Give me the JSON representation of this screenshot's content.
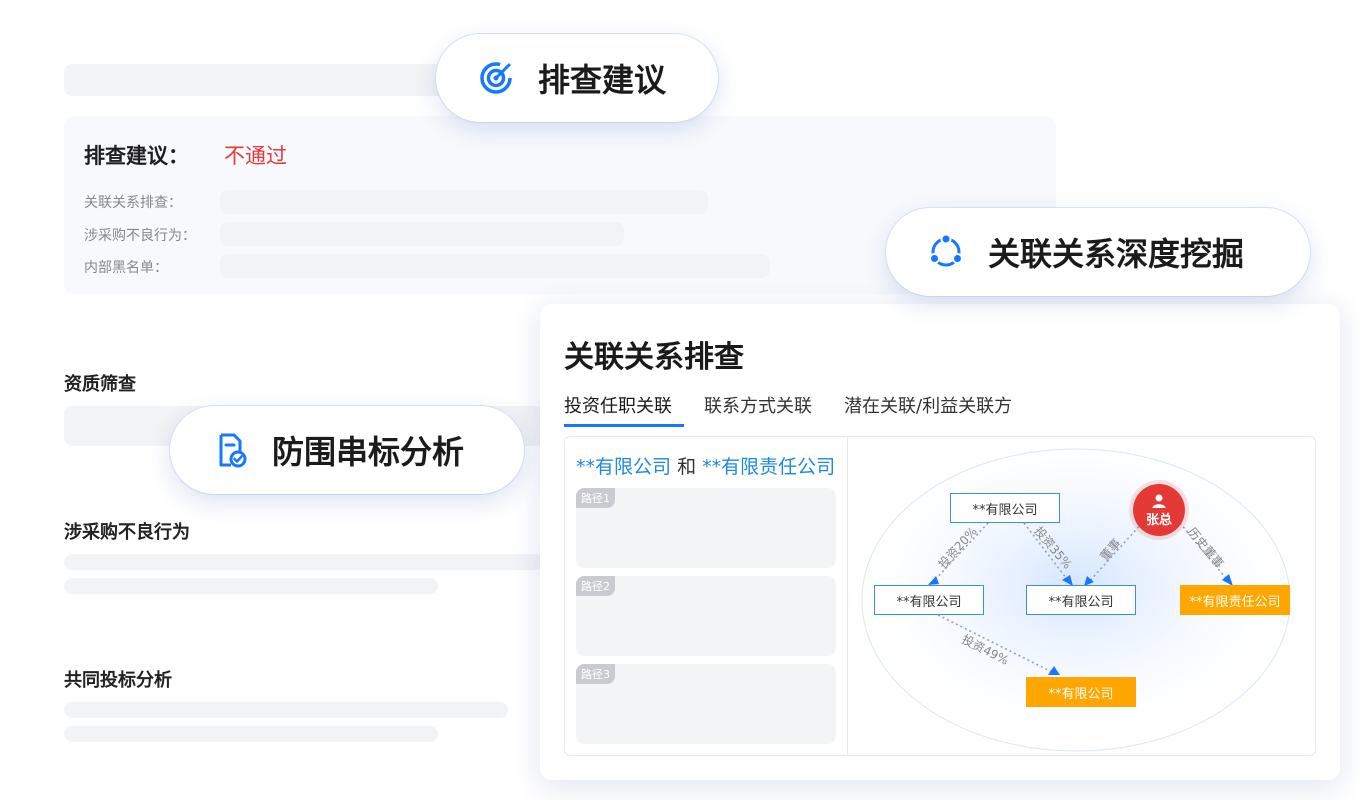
{
  "review": {
    "title": "排查建议：",
    "result": "不通过",
    "items": [
      {
        "label": "关联关系排查："
      },
      {
        "label": "涉采购不良行为："
      },
      {
        "label": "内部黑名单："
      }
    ]
  },
  "sections": {
    "qualification": "资质筛查",
    "bad_behavior": "涉采购不良行为",
    "joint_bidding": "共同投标分析"
  },
  "bubbles": {
    "suggestion": {
      "label": "排查建议",
      "icon": "target-icon"
    },
    "relation_mining": {
      "label": "关联关系深度挖掘",
      "icon": "network-icon"
    },
    "anti_collusion": {
      "label": "防围串标分析",
      "icon": "document-check-icon"
    }
  },
  "relation_card": {
    "title": "关联关系排查",
    "tabs": [
      {
        "label": "投资任职关联",
        "active": true
      },
      {
        "label": "联系方式关联",
        "active": false
      },
      {
        "label": "潜在关联/利益关联方",
        "active": false
      }
    ],
    "companies": {
      "a": "**有限公司",
      "and": "和",
      "b": "**有限责任公司"
    },
    "paths": [
      {
        "label": "路径1"
      },
      {
        "label": "路径2"
      },
      {
        "label": "路径3"
      }
    ],
    "graph": {
      "person": "张总",
      "nodes": {
        "top": "**有限公司",
        "left": "**有限公司",
        "middle": "**有限公司",
        "right": "**有限责任公司",
        "bottom": "**有限公司"
      },
      "edges": {
        "top_left": "投资20%",
        "top_middle": "投资35%",
        "person_middle": "董事",
        "person_right": "历史董事",
        "left_bottom": "投资49%"
      }
    }
  },
  "colors": {
    "accent": "#1677ff",
    "fail": "#e63a3a",
    "orange": "#ffa600",
    "person": "#e53935"
  }
}
